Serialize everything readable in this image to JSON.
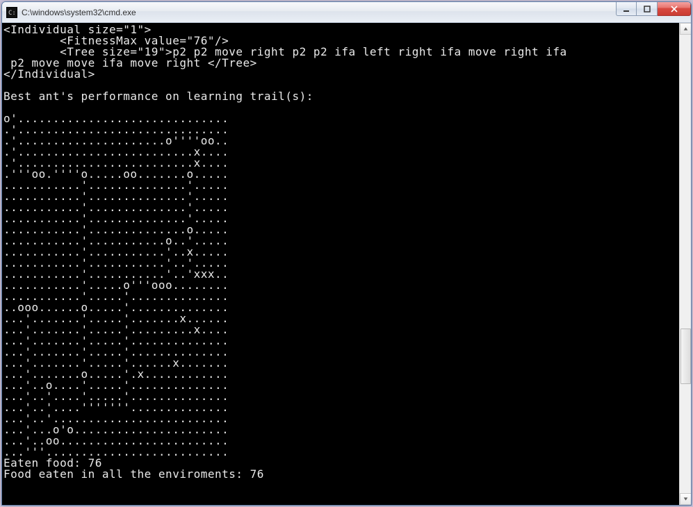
{
  "window": {
    "title": "C:\\windows\\system32\\cmd.exe",
    "icon": "cmd-icon"
  },
  "controls": {
    "minimize": "minimize",
    "maximize": "maximize",
    "close": "close"
  },
  "console": {
    "lines": [
      "<Individual size=\"1\">",
      "        <FitnessMax value=\"76\"/>",
      "        <Tree size=\"19\">p2 p2 move right p2 p2 ifa left right ifa move right ifa",
      " p2 move move ifa move right </Tree>",
      "</Individual>",
      "",
      "Best ant's performance on learning trail(s):",
      "",
      "o'..............................",
      ".'..............................",
      ".'.....................o''''oo..",
      ".'.........................x....",
      ".'.........................x....",
      ".'''oo.''''o.....oo.......o.....",
      "...........'..............'.....",
      "...........'..............'.....",
      "...........'..............'.....",
      "...........'..............'.....",
      "...........'..............o.....",
      "...........'...........o..'.....",
      "...........'...........'..x.....",
      "...........'...........'..'.....",
      "...........'...........'..'xxx..",
      "...........'.....o'''ooo........",
      "...........'.....'..............",
      "..ooo......o.....'..............",
      "...'.......'.....'.......x......",
      "...'.......'.....'.........x....",
      "...'.......'.....'..............",
      "...'.......'.....'..............",
      "...'.......'.....'......x.......",
      "...'.......o.....'.x............",
      "...'..o....'.....'..............",
      "...'..'....'.....'..............",
      "...'..'....'''''''..............",
      "...'..'.........................",
      "...'...o'o......................",
      "...'..oo........................",
      "...'''..........................",
      "Eaten food: 76",
      "Food eaten in all the enviroments: 76"
    ]
  }
}
